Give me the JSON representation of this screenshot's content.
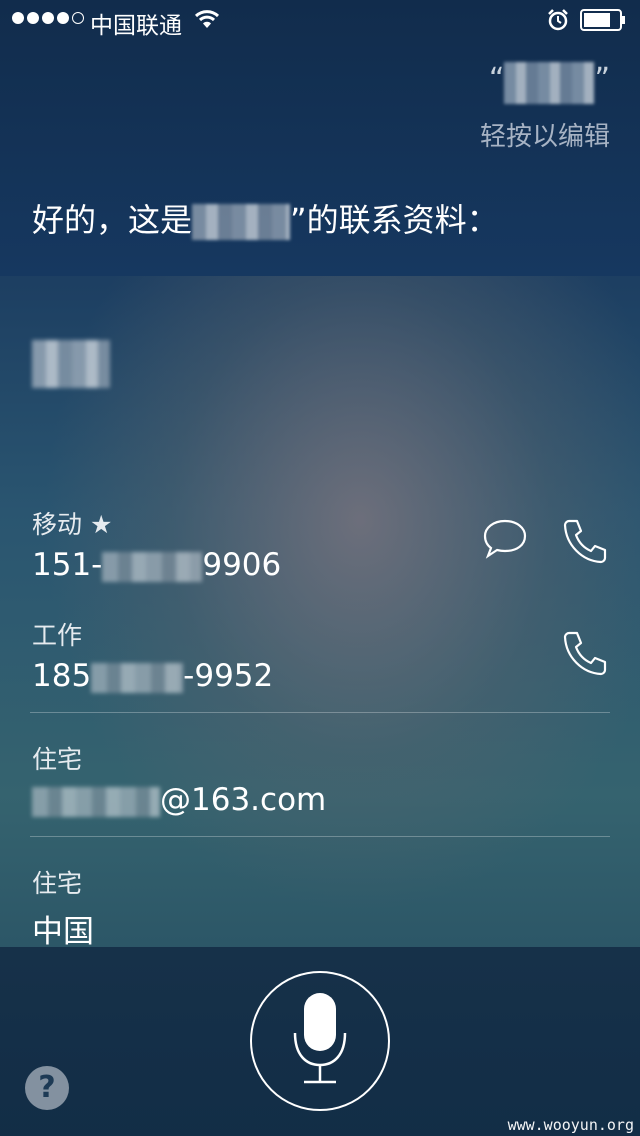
{
  "status_bar": {
    "carrier": "中国联通",
    "signal_bars_filled": 4,
    "signal_bars_total": 5
  },
  "siri": {
    "query_hint": "轻按以编辑",
    "response_prefix": "好的，这是",
    "response_suffix": "”的联系资料："
  },
  "contact": {
    "fields": [
      {
        "label": "移动 ★",
        "value_prefix": "151-",
        "value_suffix": "9906"
      },
      {
        "label": "工作",
        "value_prefix": "185",
        "value_suffix": "-9952"
      },
      {
        "label": "住宅",
        "value_prefix": "",
        "value_suffix": "@163.com"
      },
      {
        "label": "住宅",
        "value_prefix": "",
        "value_suffix": "中国"
      }
    ]
  },
  "help": {
    "label": "?"
  },
  "watermark": "www.wooyun.org"
}
